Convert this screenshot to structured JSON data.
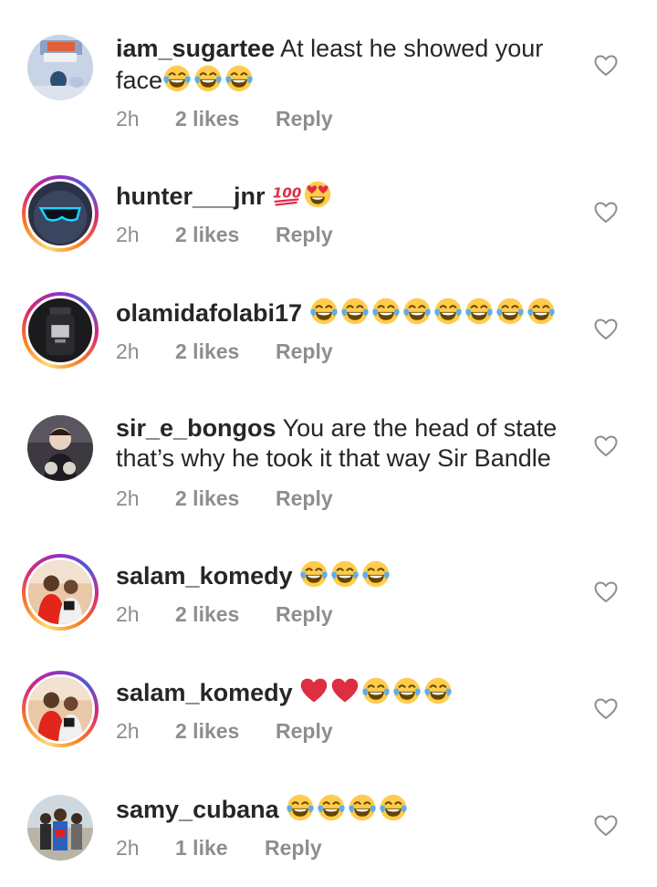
{
  "comments": [
    {
      "username": "iam_sugartee",
      "text": "At least he showed your face",
      "emoji_count": 3,
      "time": "2h",
      "likes": "2 likes",
      "reply": "Reply",
      "ring": false,
      "avatar": "room"
    },
    {
      "username": "hunter___jnr",
      "text": "",
      "emoji": "100, heart-eyes",
      "time": "2h",
      "likes": "2 likes",
      "reply": "Reply",
      "ring": true,
      "avatar": "sunglasses"
    },
    {
      "username": "olamidafolabi17",
      "text": "",
      "emoji_count": 8,
      "time": "2h",
      "likes": "2 likes",
      "reply": "Reply",
      "ring": true,
      "avatar": "bottle"
    },
    {
      "username": "sir_e_bongos",
      "text": "You are the head of state that’s why he took it that way Sir Bandle",
      "time": "2h",
      "likes": "2 likes",
      "reply": "Reply",
      "ring": false,
      "avatar": "child"
    },
    {
      "username": "salam_komedy",
      "text": "",
      "emoji_count": 3,
      "time": "2h",
      "likes": "2 likes",
      "reply": "Reply",
      "ring": true,
      "avatar": "people"
    },
    {
      "username": "salam_komedy",
      "text": "",
      "emoji": "2 red hearts, 3 joy",
      "time": "2h",
      "likes": "2 likes",
      "reply": "Reply",
      "ring": true,
      "avatar": "people"
    },
    {
      "username": "samy_cubana",
      "text": "",
      "emoji_count": 4,
      "time": "2h",
      "likes": "1 like",
      "reply": "Reply",
      "ring": false,
      "avatar": "group"
    }
  ],
  "colors": {
    "text": "#262626",
    "meta": "#8e8e8e",
    "heart_outline": "#8e8e8e"
  },
  "icons": {
    "like": "heart-outline-icon",
    "emoji_joy": "face-with-tears-of-joy-icon",
    "emoji_heart": "red-heart-icon",
    "emoji_100": "hundred-points-icon",
    "emoji_heart_eyes": "heart-eyes-icon"
  }
}
